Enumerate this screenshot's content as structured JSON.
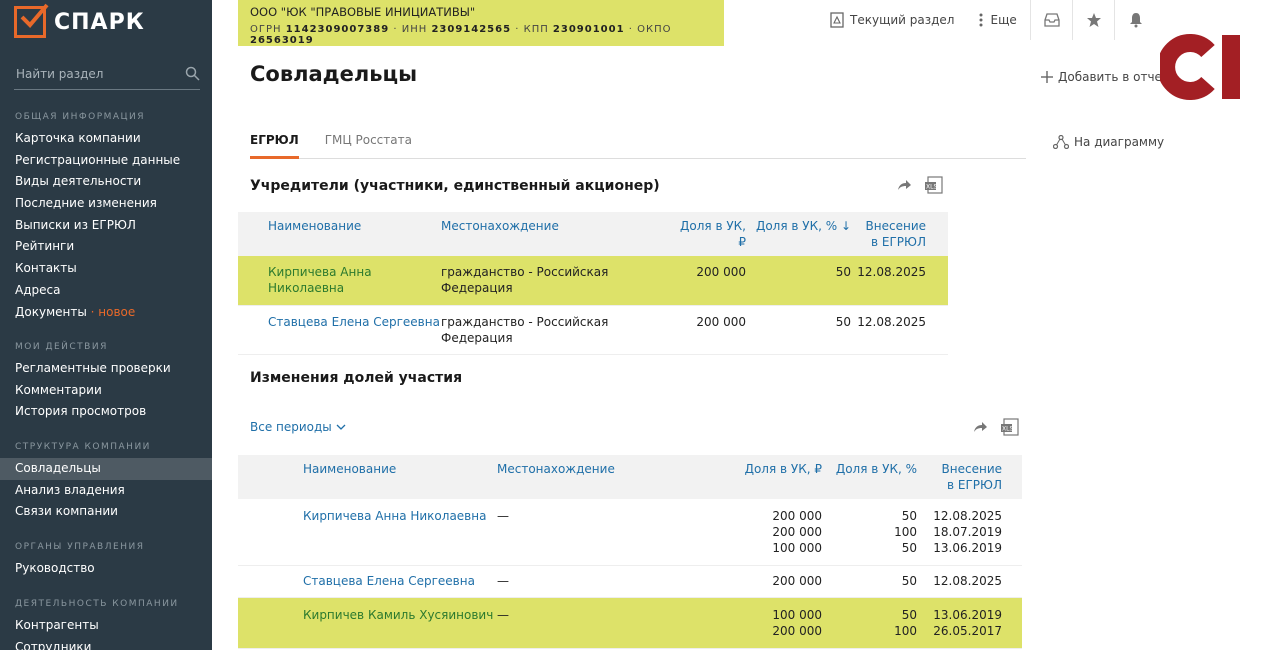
{
  "sidebar": {
    "logo_text": "СПАРК",
    "search_placeholder": "Найти раздел",
    "sections": [
      {
        "head": "ОБЩАЯ ИНФОРМАЦИЯ",
        "items": [
          "Карточка компании",
          "Регистрационные данные",
          "Виды деятельности",
          "Последние изменения",
          "Выписки из ЕГРЮЛ",
          "Рейтинги",
          "Контакты",
          "Адреса"
        ]
      },
      {
        "head": "МОИ ДЕЙСТВИЯ",
        "items": [
          "Регламентные проверки",
          "Комментарии",
          "История просмотров"
        ]
      },
      {
        "head": "СТРУКТУРА КОМПАНИИ",
        "items": [
          "Совладельцы",
          "Анализ владения",
          "Связи компании"
        ]
      },
      {
        "head": "ОРГАНЫ УПРАВЛЕНИЯ",
        "items": [
          "Руководство"
        ]
      },
      {
        "head": "ДЕЯТЕЛЬНОСТЬ КОМПАНИИ",
        "items": [
          "Контрагенты",
          "Сотрудники"
        ]
      }
    ],
    "documents_label": "Документы",
    "documents_badge": "новое"
  },
  "company": {
    "name": "ООО \"ЮК \"ПРАВОВЫЕ ИНИЦИАТИВЫ\"",
    "ogrn_label": "ОГРН",
    "ogrn": "1142309007389",
    "inn_label": "ИНН",
    "inn": "2309142565",
    "kpp_label": "КПП",
    "kpp": "230901001",
    "okpo_label": "ОКПО",
    "okpo": "26563019"
  },
  "top": {
    "current_section": "Текущий раздел",
    "more": "Еще"
  },
  "page": {
    "title": "Совладельцы",
    "add_report": "Добавить в отчет",
    "on_diagram": "На диаграмму",
    "tabs": [
      "ЕГРЮЛ",
      "ГМЦ Росстата"
    ]
  },
  "founders": {
    "title": "Учредители (участники, единственный акционер)",
    "headers": {
      "name": "Наименование",
      "location": "Местонахождение",
      "share_rub": "Доля в УК, ₽",
      "share_pct": "Доля в УК, % ↓",
      "date1": "Внесение",
      "date2": "в ЕГРЮЛ"
    },
    "rows": [
      {
        "name": "Кирпичева Анна Николаевна",
        "location": "гражданство - Российская Федерация",
        "rub": "200 000",
        "pct": "50",
        "date": "12.08.2025"
      },
      {
        "name": "Ставцева Елена Сергеевна",
        "location": "гражданство - Российская Федерация",
        "rub": "200 000",
        "pct": "50",
        "date": "12.08.2025"
      }
    ]
  },
  "changes": {
    "title": "Изменения долей участия",
    "periods": "Все периоды",
    "headers": {
      "name": "Наименование",
      "location": "Местонахождение",
      "share_rub": "Доля в УК, ₽",
      "share_pct": "Доля в УК, %",
      "date1": "Внесение",
      "date2": "в ЕГРЮЛ"
    },
    "rows": [
      {
        "name": "Кирпичева Анна Николаевна",
        "location": "—",
        "rub": "200 000\n200 000\n100 000",
        "pct": "50\n100\n50",
        "date": "12.08.2025\n18.07.2019\n13.06.2019"
      },
      {
        "name": "Ставцева Елена Сергеевна",
        "location": "—",
        "rub": "200 000",
        "pct": "50",
        "date": "12.08.2025"
      },
      {
        "name": "Кирпичев Камиль Хусяинович",
        "location": "—",
        "rub": "100 000\n200 000",
        "pct": "50\n100",
        "date": "13.06.2019\n26.05.2017"
      }
    ]
  },
  "colors": {
    "accent": "#e8692a",
    "highlight": "#dde269",
    "sidebar": "#2b3a45",
    "link": "#1f6fa8"
  }
}
